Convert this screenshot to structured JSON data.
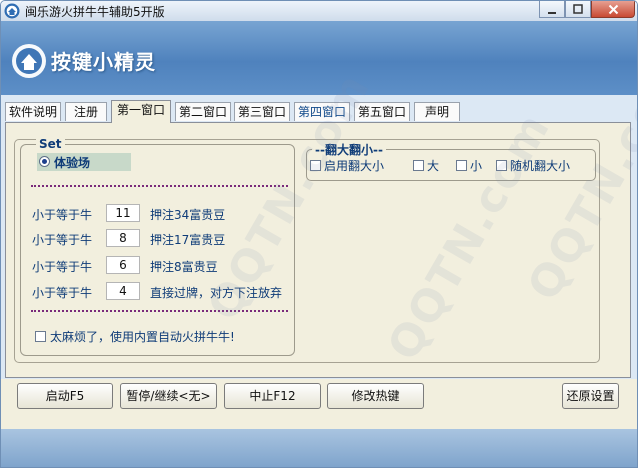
{
  "window": {
    "title": "闽乐游火拼牛牛辅助5开版"
  },
  "banner": {
    "title": "按键小精灵"
  },
  "tabs": [
    {
      "label": "软件说明"
    },
    {
      "label": "注册"
    },
    {
      "label": "第一窗口"
    },
    {
      "label": "第二窗口"
    },
    {
      "label": "第三窗口"
    },
    {
      "label": "第四窗口"
    },
    {
      "label": "第五窗口"
    },
    {
      "label": "声明"
    }
  ],
  "set_group": {
    "legend": "Set",
    "radio_label": "体验场",
    "rows": [
      {
        "label": "小于等于牛",
        "value": "11",
        "desc": "押注34富贵豆"
      },
      {
        "label": "小于等于牛",
        "value": "8",
        "desc": "押注17富贵豆"
      },
      {
        "label": "小于等于牛",
        "value": "6",
        "desc": "押注8富贵豆"
      },
      {
        "label": "小于等于牛",
        "value": "4",
        "desc": "直接过牌，对方下注放弃"
      }
    ],
    "auto_checkbox_label": "太麻烦了，使用内置自动火拼牛牛!"
  },
  "flip_group": {
    "legend": "--翻大翻小--",
    "options": [
      {
        "label": "启用翻大小"
      },
      {
        "label": "大"
      },
      {
        "label": "小"
      },
      {
        "label": "随机翻大小"
      }
    ]
  },
  "buttons": {
    "start": "启动F5",
    "pause": "暂停/继续<无>",
    "stop": "中止F12",
    "hotkey": "修改热键",
    "restore": "还原设置"
  },
  "watermark": "QQTN.com",
  "colors": {
    "banner": "#4f82bd",
    "panel": "#f2efde",
    "label_text": "#0f3c78"
  }
}
